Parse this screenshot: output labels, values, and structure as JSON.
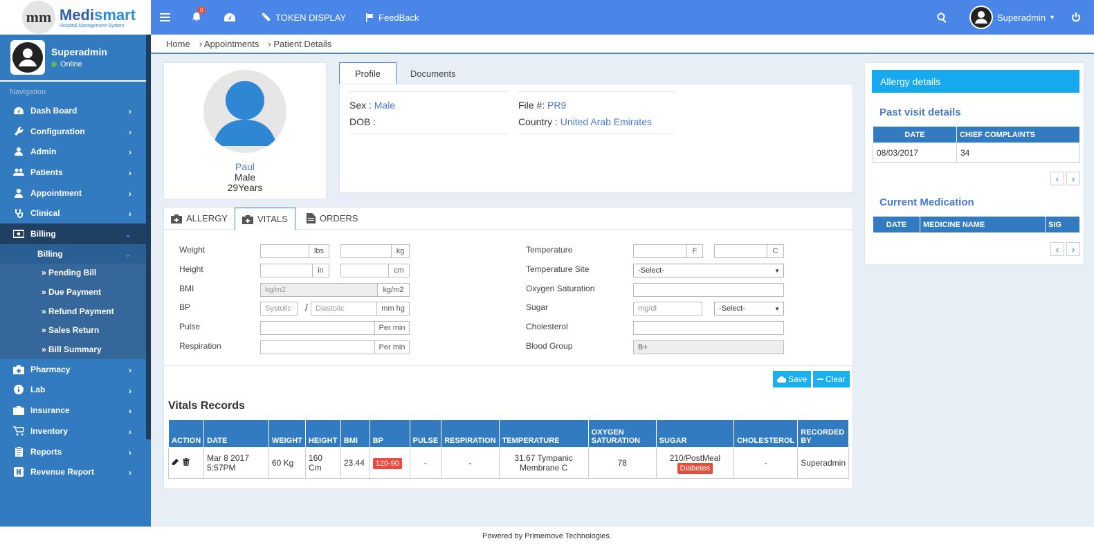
{
  "app": {
    "logo_mark": "m",
    "logo_name_1": "Medi",
    "logo_name_2": "smart",
    "logo_sub": "Hospital Management System"
  },
  "topbar": {
    "notif_count": "0",
    "token_display": "TOKEN DISPLAY",
    "feedback": "FeedBack",
    "user": "Superadmin"
  },
  "sidebar": {
    "user_name": "Superadmin",
    "status": "Online",
    "nav_label": "Navigation",
    "items": [
      "Dash Board",
      "Configuration",
      "Admin",
      "Patients",
      "Appointment",
      "Clinical",
      "Billing"
    ],
    "sub_billing": "Billing",
    "sub_items": [
      "» Pending Bill",
      "» Due Payment",
      "» Refund Payment",
      "» Sales Return",
      "» Bill Summary"
    ],
    "items2": [
      "Pharmacy",
      "Lab",
      "Insurance",
      "Inventory",
      "Reports",
      "Revenue Report"
    ]
  },
  "breadcrumb": [
    "Home",
    "›  Appointments",
    "›  Patient Details"
  ],
  "profile": {
    "name": "Paul",
    "sex": "Male",
    "age": "29Years"
  },
  "tabs": {
    "profile": "Profile",
    "documents": "Documents"
  },
  "info": {
    "sex_label": "Sex :",
    "sex_value": "Male",
    "dob_label": "DOB :",
    "file_label": "File #:",
    "file_value": "PR9",
    "country_label": "Country :",
    "country_value": "United Arab Emirates"
  },
  "vtabs": {
    "allergy": "ALLERGY",
    "vitals": "VITALS",
    "orders": "ORDERS"
  },
  "form": {
    "weight": "Weight",
    "height": "Height",
    "bmi": "BMI",
    "bp": "BP",
    "pulse": "Pulse",
    "respiration": "Respiration",
    "temperature": "Temperature",
    "temp_site": "Temperature Site",
    "oxygen": "Oxygen Saturation",
    "sugar": "Sugar",
    "cholesterol": "Cholesterol",
    "blood_group": "Blood Group",
    "lbs": "lbs",
    "kg": "kg",
    "in": "in",
    "cm": "cm",
    "kgm2": "kg/m2",
    "bmi_placeholder": "kg/m2",
    "systolic": "Systolic",
    "slash": "/",
    "diastolic": "Diastolic",
    "mmhg": "mm hg",
    "permin": "Per min",
    "f": "F",
    "c": "C",
    "select": "-Select-",
    "mgdl": "mg/dl",
    "blood_value": "B+"
  },
  "buttons": {
    "save": "Save",
    "clear": "Clear"
  },
  "vitals_records": {
    "title": "Vitals Records",
    "headers": [
      "ACTION",
      "DATE",
      "WEIGHT",
      "HEIGHT",
      "BMI",
      "BP",
      "PULSE",
      "RESPIRATION",
      "TEMPERATURE",
      "OXYGEN SATURATION",
      "SUGAR",
      "CHOLESTEROL",
      "RECORDED BY"
    ],
    "row": {
      "date": "Mar 8 2017 5:57PM",
      "weight": "60 Kg",
      "height": "160 Cm",
      "bmi": "23.44",
      "bp": "120-90",
      "pulse": "-",
      "respiration": "-",
      "temperature": "31.67 Tympanic Membrane C",
      "oxygen": "78",
      "sugar": "210/PostMeal",
      "sugar_badge": "Diabetes",
      "cholesterol": "-",
      "recorded_by": "Superadmin"
    }
  },
  "right": {
    "allergy_title": "Allergy details",
    "past_visit_title": "Past visit details",
    "past_headers": [
      "DATE",
      "CHIEF COMPLAINTS"
    ],
    "past_row": {
      "date": "08/03/2017",
      "complaint": "34"
    },
    "medication_title": "Current Medication",
    "med_headers": [
      "DATE",
      "MEDICINE NAME",
      "SIG"
    ]
  },
  "footer": "Powered by Primemove Technologies.",
  "colors": {
    "topbar": "#4a86e8",
    "sidebar": "#337bc0",
    "accent": "#17a9f0",
    "danger": "#e74c3c"
  }
}
